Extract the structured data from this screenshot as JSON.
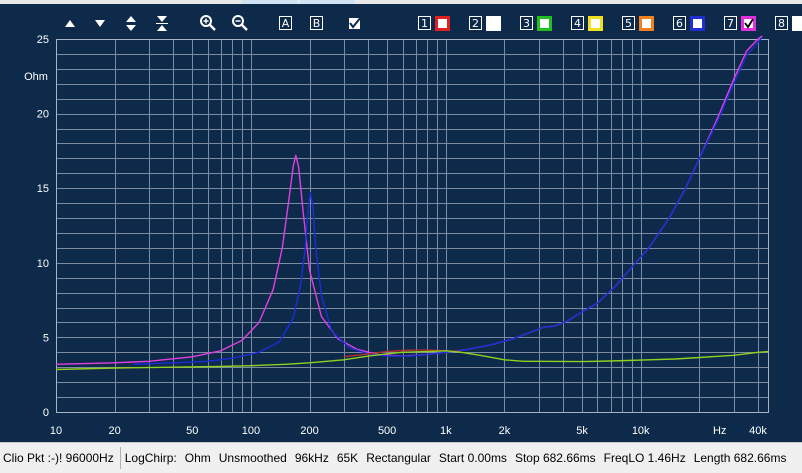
{
  "status_bar": {
    "device": "Clio Pkt :-)! 96000Hz",
    "mode": "LogChirp:",
    "unit": "Ohm",
    "smoothing": "Unsmoothed",
    "rate": "96kHz",
    "size": "65K",
    "window": "Rectangular",
    "start": "Start 0.00ms",
    "stop": "Stop 682.66ms",
    "freqlo": "FreqLO 1.46Hz",
    "length": "Length 682.66ms"
  },
  "toolbar": {
    "icons": [
      "arrow-up-icon",
      "arrow-down-icon",
      "expand-vertical-icon",
      "compress-vertical-icon",
      "zoom-in-icon",
      "zoom-out-icon",
      "marker-a-icon",
      "marker-b-icon",
      "checkbox-icon"
    ],
    "marker_a": "A",
    "marker_b": "B",
    "traces": [
      {
        "num": "1",
        "color": "#e02020",
        "checked": false
      },
      {
        "num": "2",
        "color": "#ffffff",
        "checked": false
      },
      {
        "num": "3",
        "color": "#20c020",
        "checked": false
      },
      {
        "num": "4",
        "color": "#f0e020",
        "checked": false
      },
      {
        "num": "5",
        "color": "#f08020",
        "checked": false
      },
      {
        "num": "6",
        "color": "#2030d0",
        "checked": false
      },
      {
        "num": "7",
        "color": "#e030e0",
        "checked": true
      },
      {
        "num": "8",
        "color": "#ffffff",
        "checked": false
      }
    ]
  },
  "chart_data": {
    "type": "line",
    "xscale": "log",
    "xlim": [
      10,
      45000
    ],
    "ylim": [
      0,
      25
    ],
    "ylabel": "Ohm",
    "xunit_label": "Hz",
    "grid": true,
    "background": "#0d2a4a",
    "grid_color": "#7b8ba2",
    "x_ticks": [
      {
        "value": 10,
        "label": "10"
      },
      {
        "value": 20,
        "label": "20"
      },
      {
        "value": 50,
        "label": "50"
      },
      {
        "value": 100,
        "label": "100"
      },
      {
        "value": 200,
        "label": "200"
      },
      {
        "value": 500,
        "label": "500"
      },
      {
        "value": 1000,
        "label": "1k"
      },
      {
        "value": 2000,
        "label": "2k"
      },
      {
        "value": 5000,
        "label": "5k"
      },
      {
        "value": 10000,
        "label": "10k"
      },
      {
        "value": 40000,
        "label": "40k"
      }
    ],
    "y_ticks": [
      {
        "value": 0,
        "label": "0"
      },
      {
        "value": 5,
        "label": "5"
      },
      {
        "value": 10,
        "label": "10"
      },
      {
        "value": 15,
        "label": "15"
      },
      {
        "value": 20,
        "label": "20"
      },
      {
        "value": 25,
        "label": "25"
      }
    ],
    "series": [
      {
        "color": "#e040e0",
        "x": [
          10,
          20,
          30,
          50,
          70,
          90,
          110,
          130,
          145,
          158,
          165,
          170,
          176,
          185,
          200,
          230,
          280,
          350,
          450,
          600,
          800,
          1000,
          1300,
          1700,
          2200,
          2800,
          3200,
          3600,
          4200,
          5000,
          6000,
          7500,
          9000,
          11000,
          14000,
          17000,
          20000,
          25000,
          30000,
          35000,
          40000,
          42000
        ],
        "y": [
          3.2,
          3.3,
          3.4,
          3.7,
          4.1,
          4.8,
          6.0,
          8.2,
          11.0,
          14.6,
          16.5,
          17.2,
          16.4,
          13.5,
          9.5,
          6.4,
          4.9,
          4.2,
          3.85,
          3.75,
          3.85,
          4.0,
          4.2,
          4.5,
          4.9,
          5.4,
          5.7,
          5.75,
          6.1,
          6.7,
          7.3,
          8.5,
          9.7,
          11.0,
          13.0,
          15.0,
          17.0,
          19.8,
          22.3,
          24.2,
          25.0,
          25.2
        ]
      },
      {
        "color": "#1a2ed8",
        "x": [
          25,
          40,
          60,
          80,
          110,
          140,
          165,
          180,
          190,
          197,
          202,
          208,
          215,
          230,
          260,
          320,
          400,
          500,
          650,
          800,
          1000,
          1300,
          1700,
          2200,
          2800,
          3200,
          3600,
          4200,
          5000,
          6000,
          7500,
          9000,
          11000,
          14000,
          17000,
          20000,
          25000,
          30000,
          35000,
          40000,
          42000
        ],
        "y": [
          3.2,
          3.3,
          3.4,
          3.6,
          4.0,
          4.7,
          6.3,
          8.5,
          11.0,
          13.7,
          14.7,
          13.8,
          11.0,
          7.8,
          5.4,
          4.3,
          3.9,
          3.75,
          3.75,
          3.85,
          4.0,
          4.2,
          4.5,
          4.9,
          5.4,
          5.7,
          5.75,
          6.1,
          6.7,
          7.3,
          8.5,
          9.7,
          11.0,
          13.0,
          15.0,
          17.0,
          19.6,
          22.0,
          23.9,
          24.8,
          25.1
        ]
      },
      {
        "color": "#b03030",
        "x": [
          300,
          400,
          500,
          600,
          700,
          800,
          900,
          1000,
          1200
        ],
        "y": [
          3.7,
          3.9,
          4.05,
          4.12,
          4.15,
          4.15,
          4.12,
          4.1,
          4.05
        ]
      },
      {
        "color": "#90d020",
        "x": [
          10,
          20,
          40,
          70,
          100,
          150,
          200,
          300,
          400,
          500,
          600,
          800,
          1000,
          1200,
          1500,
          2000,
          2500,
          3000,
          5000,
          7000,
          10000,
          15000,
          20000,
          30000,
          40000,
          45000
        ],
        "y": [
          2.85,
          2.95,
          3.0,
          3.05,
          3.1,
          3.2,
          3.3,
          3.5,
          3.75,
          3.9,
          4.0,
          4.05,
          4.1,
          4.0,
          3.8,
          3.5,
          3.4,
          3.4,
          3.38,
          3.42,
          3.48,
          3.55,
          3.65,
          3.8,
          4.0,
          4.05
        ]
      }
    ]
  }
}
